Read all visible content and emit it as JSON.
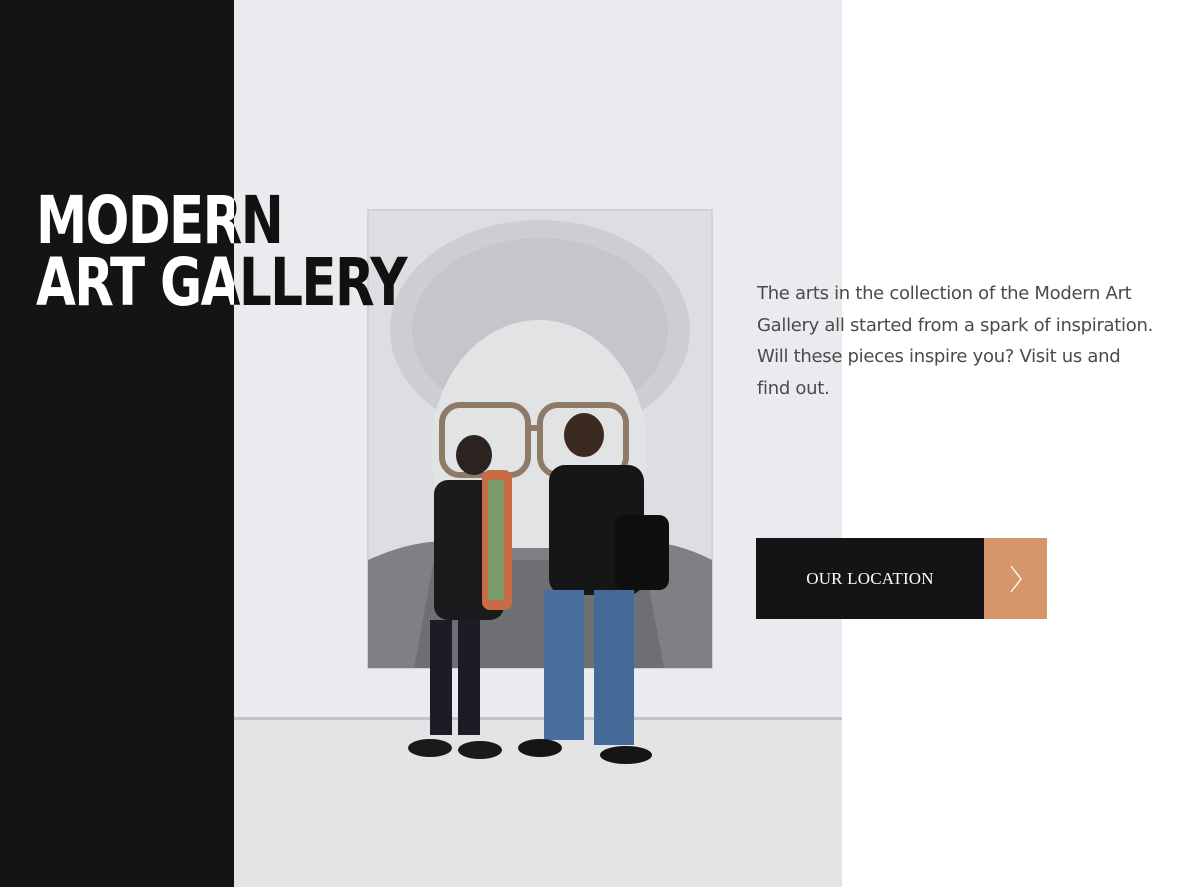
{
  "hero": {
    "title_line1": "MODERN",
    "title_line2": "ART GALLERY",
    "image_alt": "Two visitors looking at a large portrait drawing of an elderly woman with glasses in a white gallery"
  },
  "intro": {
    "description": "The arts in the collection of the Modern Art Gallery all started from a spark of inspiration. Will these pieces inspire you? Visit us and find out."
  },
  "cta": {
    "label": "OUR LOCATION",
    "arrow_icon": "chevron-right-icon"
  },
  "colors": {
    "dark": "#141414",
    "accent": "#d6956a",
    "text": "#4a4a4a",
    "background": "#ffffff"
  }
}
